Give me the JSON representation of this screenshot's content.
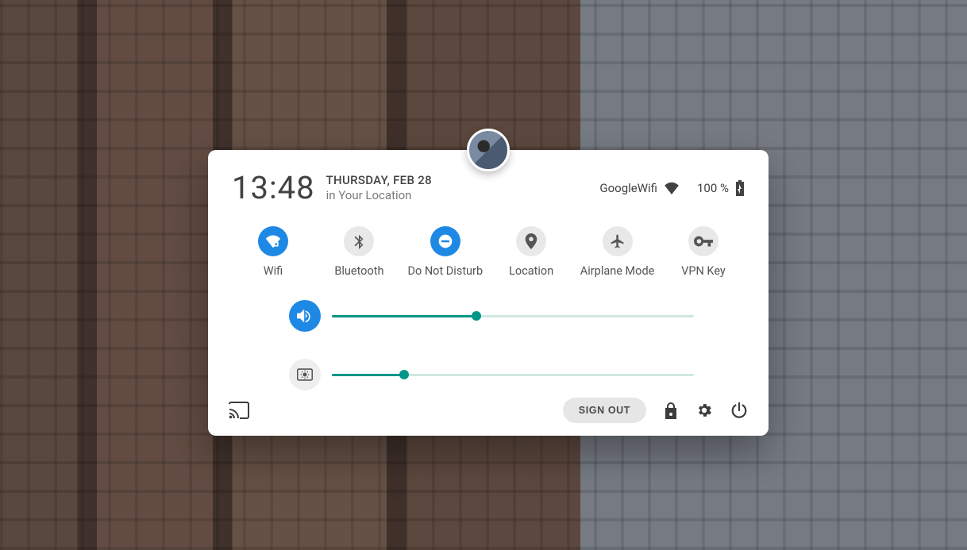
{
  "header": {
    "time": "13:48",
    "date": "THURSDAY, FEB 28",
    "location": "in Your Location",
    "wifi_name": "GoogleWifi",
    "battery_text": "100 %"
  },
  "toggles": [
    {
      "id": "wifi",
      "label": "Wifi",
      "active": true
    },
    {
      "id": "bt",
      "label": "Bluetooth",
      "active": false
    },
    {
      "id": "dnd",
      "label": "Do Not Disturb",
      "active": true
    },
    {
      "id": "location",
      "label": "Location",
      "active": false
    },
    {
      "id": "airplane",
      "label": "Airplane Mode",
      "active": false
    },
    {
      "id": "vpn",
      "label": "VPN Key",
      "active": false
    }
  ],
  "sliders": {
    "volume_pct": 40,
    "brightness_pct": 20
  },
  "footer": {
    "signout_label": "SIGN OUT"
  }
}
